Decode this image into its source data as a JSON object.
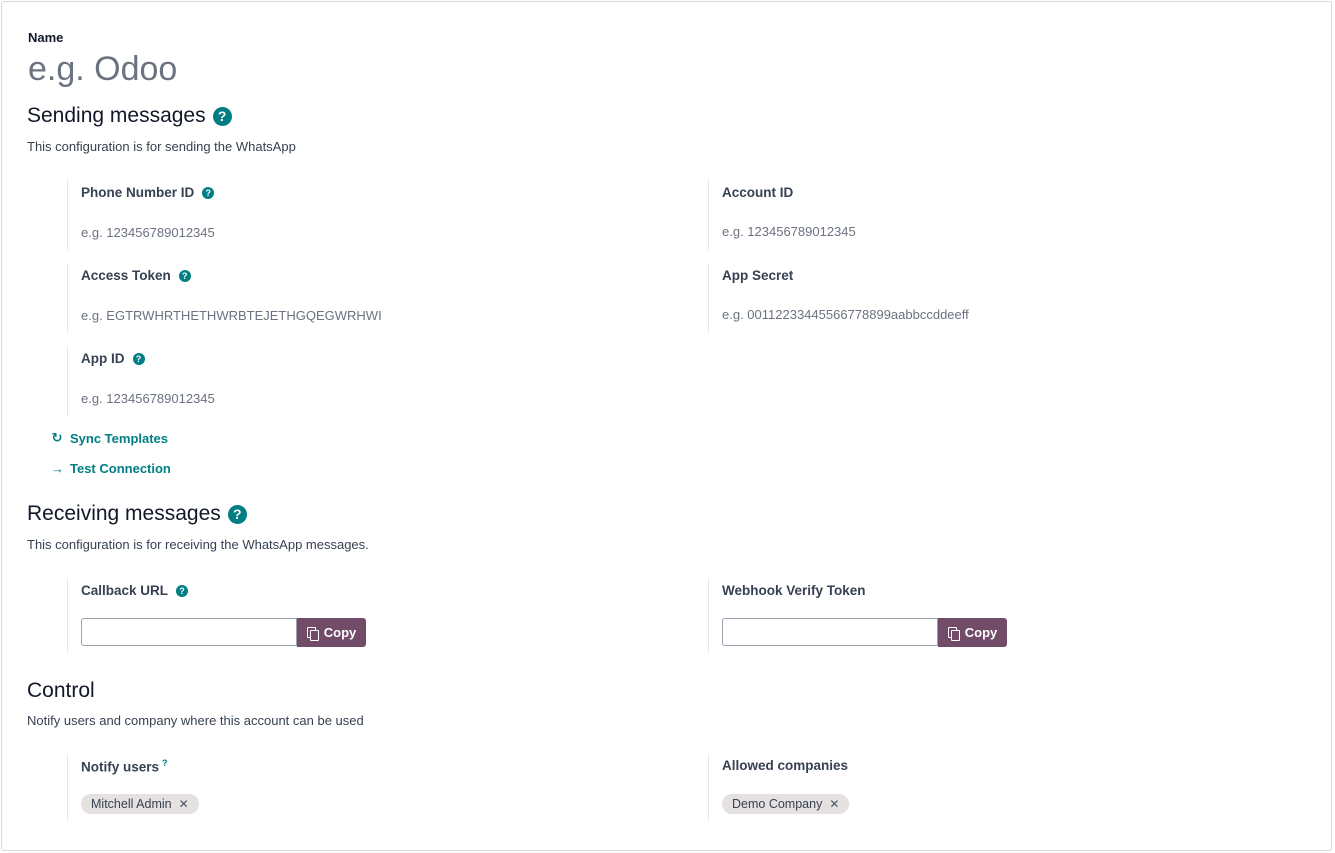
{
  "name": {
    "label": "Name",
    "placeholder": "e.g. Odoo"
  },
  "sending": {
    "title": "Sending messages",
    "description": "This configuration is for sending the WhatsApp",
    "fields": {
      "phone_number_id": {
        "label": "Phone Number ID",
        "placeholder": "e.g. 123456789012345"
      },
      "access_token": {
        "label": "Access Token",
        "placeholder": "e.g. EGTRWHRTHETHWRBTEJETHGQEGWRHWI"
      },
      "app_id": {
        "label": "App ID",
        "placeholder": "e.g. 123456789012345"
      },
      "account_id": {
        "label": "Account ID",
        "placeholder": "e.g. 123456789012345"
      },
      "app_secret": {
        "label": "App Secret",
        "placeholder": "e.g. 00112233445566778899aabbccddeeff"
      }
    },
    "actions": {
      "sync_templates": "Sync Templates",
      "test_connection": "Test Connection"
    }
  },
  "receiving": {
    "title": "Receiving messages",
    "description": "This configuration is for receiving the WhatsApp messages.",
    "callback_url": {
      "label": "Callback URL",
      "value": "",
      "copy_label": "Copy"
    },
    "webhook_verify_token": {
      "label": "Webhook Verify Token",
      "value": "",
      "copy_label": "Copy"
    }
  },
  "control": {
    "title": "Control",
    "description": "Notify users and company where this account can be used",
    "notify_users": {
      "label": "Notify users",
      "tooltip_marker": "?",
      "tags": [
        "Mitchell Admin"
      ]
    },
    "allowed_companies": {
      "label": "Allowed companies",
      "tags": [
        "Demo Company"
      ]
    }
  },
  "colors": {
    "accent": "#017e84",
    "primary": "#714b67",
    "tag_bg": "#e5e1e1"
  },
  "icons": {
    "help": "question-circle-icon",
    "sync": "refresh-icon",
    "arrow": "arrow-right-icon",
    "copy": "clipboard-icon",
    "remove": "close-icon"
  }
}
